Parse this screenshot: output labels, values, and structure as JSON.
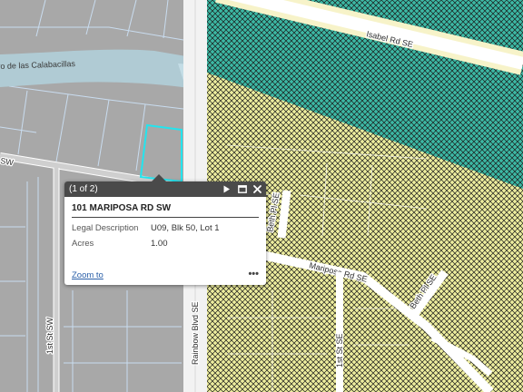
{
  "map": {
    "roads": {
      "isabel": "Isabel Rd SE",
      "rainbow": "Rainbow Blvd SE",
      "beth_upper": "Beth Pl SE",
      "beth_lower": "Beth Pl SE",
      "mariposa": "Mariposa Rd SE",
      "first_st_sw": "1st St SW",
      "first_st_se": "1st St SE",
      "sw_fragment": "SW"
    },
    "water": {
      "label_fragment": "yo de las Calabacillas"
    },
    "colors": {
      "land_gray": "#a8a8a8",
      "zone_yellow": "#eded9e",
      "zone_teal": "#3cb8a4",
      "selection": "#23e4ee",
      "water": "#b0ced8"
    }
  },
  "popup": {
    "count": "(1 of 2)",
    "title": "101 MARIPOSA RD SW",
    "attributes": [
      {
        "key": "Legal Description",
        "value": "U09, Blk 50, Lot 1"
      },
      {
        "key": "Acres",
        "value": "1.00"
      }
    ],
    "zoom_label": "Zoom to",
    "more_label": "•••"
  }
}
